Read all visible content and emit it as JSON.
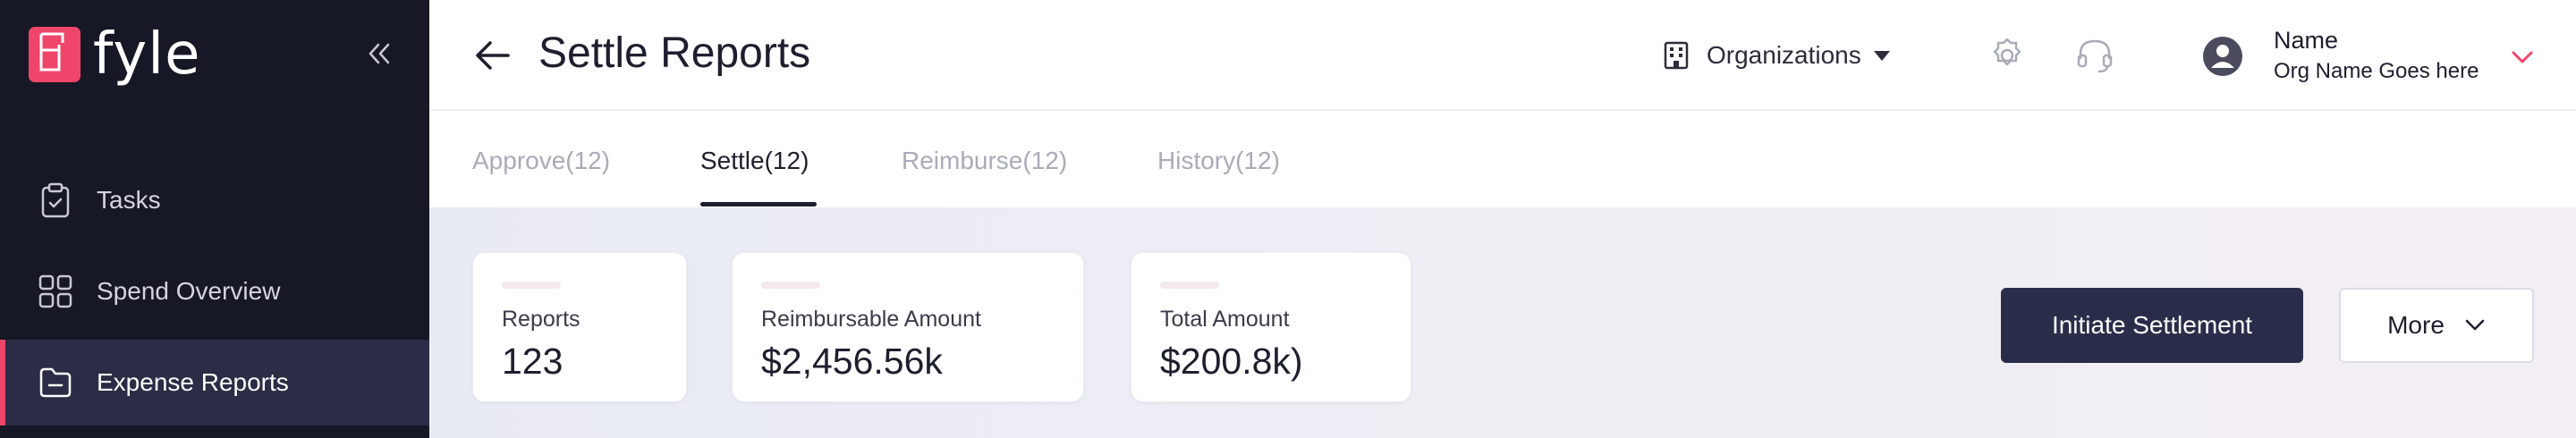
{
  "brand": {
    "logo_text": "fyle",
    "accent": "#f0456b",
    "sidebar_bg": "#171826",
    "primary_bg": "#2a2d4a"
  },
  "sidebar": {
    "collapse_icon": "double-chevron-left-icon",
    "items": [
      {
        "label": "Tasks",
        "icon": "clipboard-check-icon",
        "active": false
      },
      {
        "label": "Spend Overview",
        "icon": "grid-icon",
        "active": false
      },
      {
        "label": "Expense Reports",
        "icon": "folder-icon",
        "active": true
      }
    ]
  },
  "header": {
    "title": "Settle Reports",
    "back_icon": "arrow-left-icon",
    "org_switch_label": "Organizations",
    "user": {
      "name": "Name",
      "org": "Org Name Goes here"
    }
  },
  "tabs": [
    {
      "label": "Approve(12)",
      "active": false
    },
    {
      "label": "Settle(12)",
      "active": true
    },
    {
      "label": "Reimburse(12)",
      "active": false
    },
    {
      "label": "History(12)",
      "active": false
    }
  ],
  "stats": [
    {
      "label": "Reports",
      "value": "123"
    },
    {
      "label": "Reimbursable Amount",
      "value": "$2,456.56k"
    },
    {
      "label": "Total Amount",
      "value": "$200.8k)"
    }
  ],
  "actions": {
    "primary_label": "Initiate Settlement",
    "more_label": "More"
  }
}
